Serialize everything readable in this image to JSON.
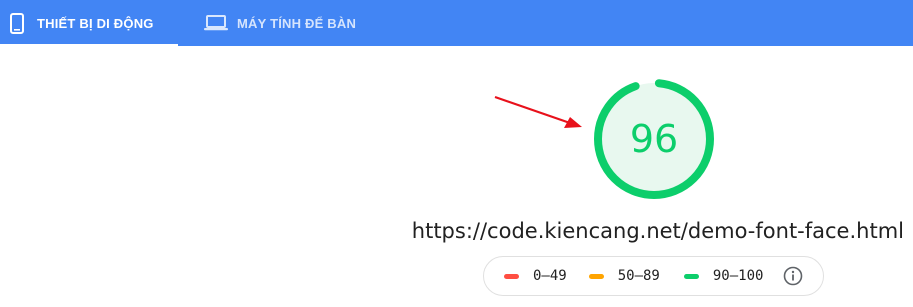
{
  "tabs": [
    {
      "label": "THIẾT BỊ DI ĐỘNG",
      "icon": "smartphone-icon",
      "active": true
    },
    {
      "label": "MÁY TÍNH ĐỂ BÀN",
      "icon": "laptop-icon",
      "active": false
    }
  ],
  "report": {
    "score": "96",
    "score_fraction": 0.96,
    "url": "https://code.kiencang.net/demo-font-face.html"
  },
  "legend": {
    "items": [
      {
        "label": "0–49",
        "color": "#ff4e42"
      },
      {
        "label": "50–89",
        "color": "#ffa400"
      },
      {
        "label": "90–100",
        "color": "#0cce6b"
      }
    ],
    "info_icon": "info-icon"
  },
  "colors": {
    "tabbar": "#4285f4",
    "pass": "#0cce6b",
    "pass_bg": "#e8f8ef",
    "annotation_arrow": "#e8111b"
  }
}
